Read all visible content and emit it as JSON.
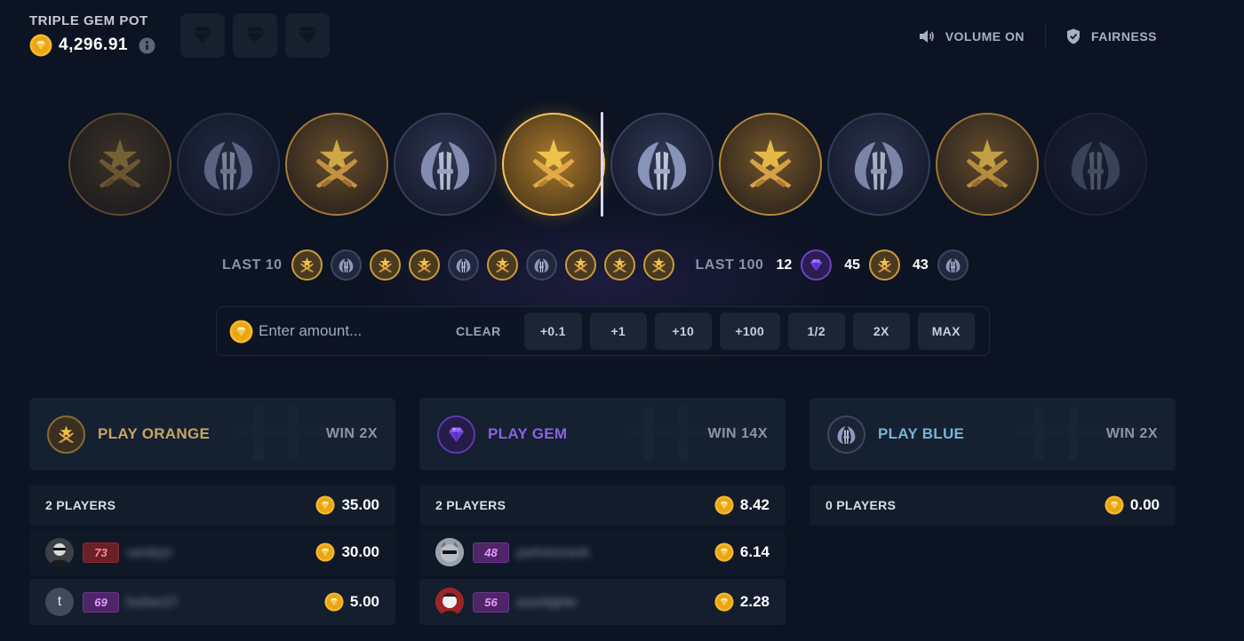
{
  "pot": {
    "title": "TRIPLE GEM POT",
    "amount": "4,296.91"
  },
  "top_actions": {
    "volume_label": "VOLUME ON",
    "fairness_label": "FAIRNESS"
  },
  "history": {
    "last10_label": "LAST 10",
    "last10": [
      "t",
      "ct",
      "t",
      "t",
      "ct",
      "t",
      "ct",
      "t",
      "t",
      "t"
    ],
    "last100_label": "LAST 100",
    "last100": {
      "gem": "12",
      "t": "45",
      "ct": "43"
    }
  },
  "bet": {
    "placeholder": "Enter amount...",
    "clear_label": "CLEAR",
    "chips": [
      "+0.1",
      "+1",
      "+10",
      "+100",
      "1/2",
      "2X",
      "MAX"
    ]
  },
  "colors": {
    "orange": "#c6a560",
    "gem": "#8a63e0",
    "blue": "#79b3d6",
    "gold": "#f5b92a"
  },
  "panels": {
    "orange": {
      "title": "PLAY ORANGE",
      "win": "WIN 2X",
      "players_label": "2 PLAYERS",
      "total": "35.00",
      "players": [
        {
          "level": "73",
          "name": "vandyyl",
          "amount": "30.00"
        },
        {
          "avatar_letter": "t",
          "level": "69",
          "name": "fusher27",
          "amount": "5.00"
        }
      ]
    },
    "gem": {
      "title": "PLAY GEM",
      "win": "WIN 14X",
      "players_label": "2 PLAYERS",
      "total": "8.42",
      "players": [
        {
          "level": "48",
          "name": "parlotomank",
          "amount": "6.14"
        },
        {
          "level": "56",
          "name": "asonlighte",
          "amount": "2.28"
        }
      ]
    },
    "blue": {
      "title": "PLAY BLUE",
      "win": "WIN 2X",
      "players_label": "0 PLAYERS",
      "total": "0.00",
      "players": []
    }
  }
}
